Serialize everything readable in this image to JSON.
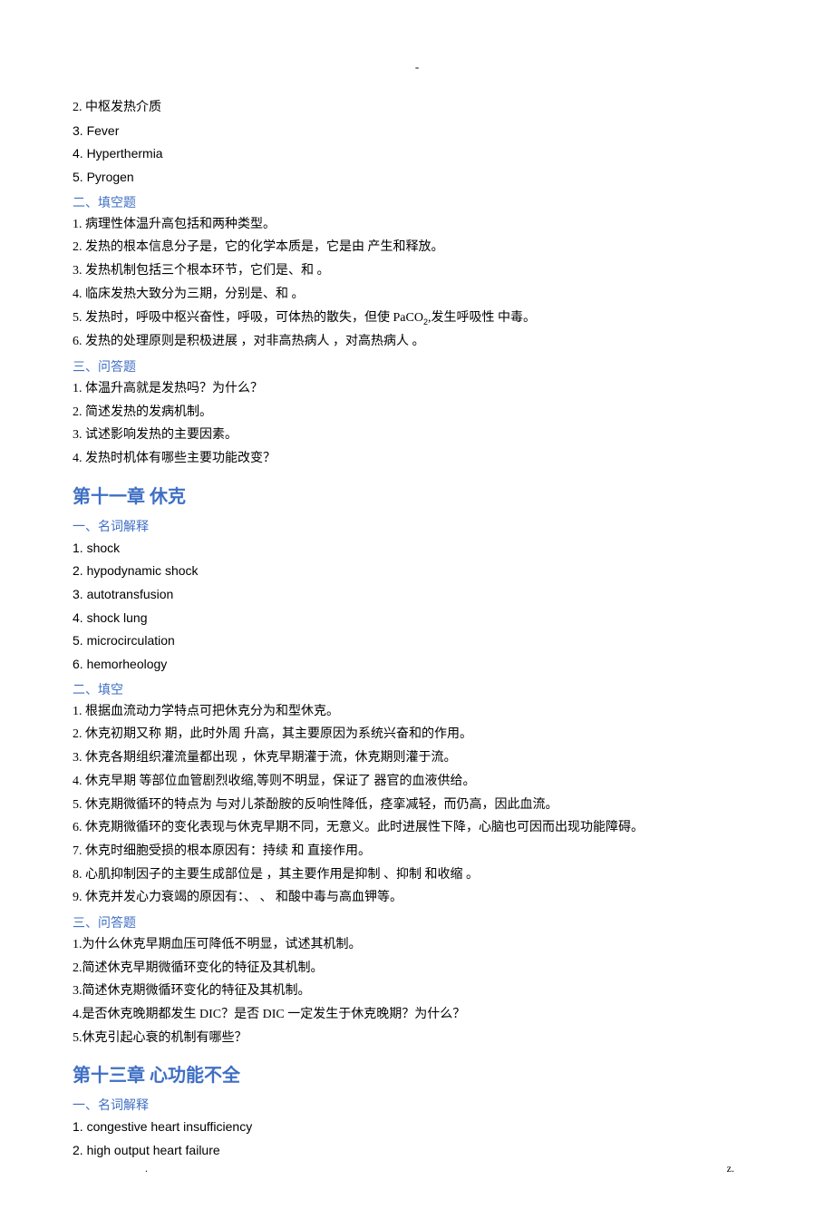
{
  "top_dash": "-",
  "prev_items": [
    "2. 中枢发热介质",
    "3. Fever",
    "4. Hyperthermia",
    "5. Pyrogen"
  ],
  "sec_fill_head": "二、填空题",
  "fill_items_1": [
    "1. 病理性体温升高包括和两种类型。",
    "2. 发热的根本信息分子是，它的化学本质是，它是由 产生和释放。",
    "3. 发热机制包括三个根本环节，它们是、和 。",
    "4. 临床发热大致分为三期，分别是、和 。"
  ],
  "fill_item_5_pre": "5. 发热时，呼吸中枢兴奋性，呼吸，可体热的散失，但使 PaCO",
  "fill_item_5_sub": "2",
  "fill_item_5_post": ",发生呼吸性 中毒。",
  "fill_item_6": "6. 发热的处理原则是积极进展 ，对非高热病人 ，对高热病人 。",
  "sec_qa_head_1": "三、问答题",
  "qa_items_1": [
    "1. 体温升高就是发热吗？为什么？",
    "2. 简述发热的发病机制。",
    "3. 试述影响发热的主要因素。",
    "4. 发热时机体有哪些主要功能改变？"
  ],
  "chapter_11": "第十一章 休克",
  "sec_term_head_1": "一、名词解释",
  "term_items_1": [
    "1. shock",
    "2. hypodynamic shock",
    "3. autotransfusion",
    "4. shock lung",
    "5. microcirculation",
    "6. hemorheology"
  ],
  "sec_fill_head_2": "二、填空",
  "fill_items_2": [
    "1. 根据血流动力学特点可把休克分为和型休克。",
    "2. 休克初期又称 期，此时外周 升高，其主要原因为系统兴奋和的作用。",
    "3. 休克各期组织灌流量都出现 ，休克早期灌于流，休克期则灌于流。",
    "4. 休克早期 等部位血管剧烈收缩,等则不明显，保证了 器官的血液供给。",
    "5. 休克期微循环的特点为 与对儿茶酚胺的反响性降低，痉挛减轻，而仍高，因此血流。",
    "6. 休克期微循环的变化表现与休克早期不同，无意义。此时进展性下降，心脑也可因而出现功能障碍。",
    "7. 休克时细胞受损的根本原因有：持续 和 直接作用。",
    "8. 心肌抑制因子的主要生成部位是 ，其主要作用是抑制 、抑制 和收缩 。",
    "9. 休克并发心力衰竭的原因有：、 、 和酸中毒与高血钾等。"
  ],
  "sec_qa_head_2": "三、问答题",
  "qa_items_2": [
    "1.为什么休克早期血压可降低不明显，试述其机制。",
    "2.简述休克早期微循环变化的特征及其机制。",
    "3.简述休克期微循环变化的特征及其机制。",
    "4.是否休克晚期都发生 DIC？是否 DIC 一定发生于休克晚期？为什么？",
    "5.休克引起心衰的机制有哪些？"
  ],
  "chapter_13": "第十三章 心功能不全",
  "sec_term_head_2": "一、名词解释",
  "term_items_2": [
    "1. congestive heart insufficiency",
    "2. high output heart failure"
  ],
  "footer_left": ".",
  "footer_right": "z."
}
